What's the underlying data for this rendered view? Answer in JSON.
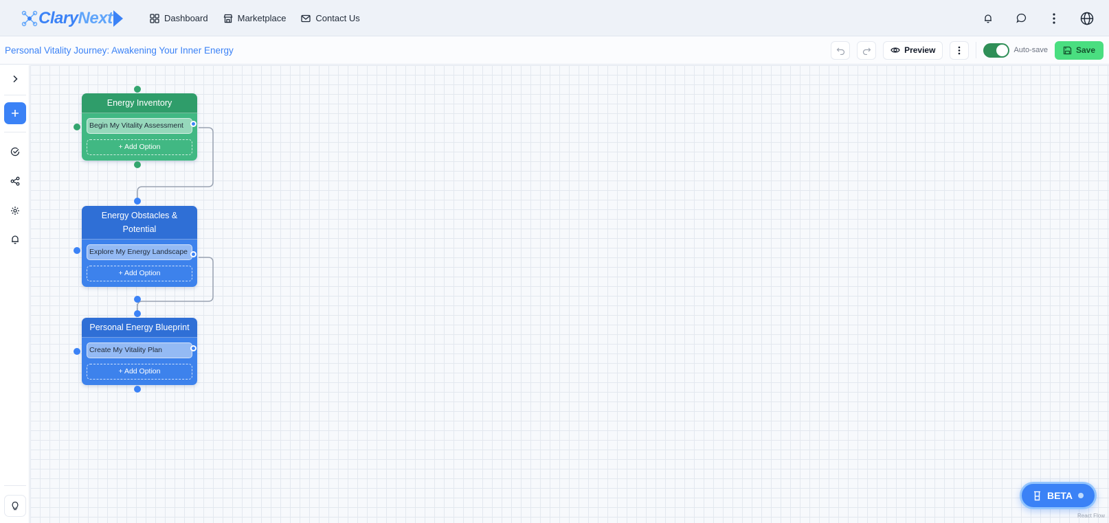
{
  "brand": {
    "part1": "Clary",
    "part2": "Next"
  },
  "nav": [
    {
      "label": "Dashboard",
      "icon": "dashboard-icon"
    },
    {
      "label": "Marketplace",
      "icon": "store-icon"
    },
    {
      "label": "Contact Us",
      "icon": "mail-icon"
    }
  ],
  "toolbar": {
    "flow_title": "Personal Vitality Journey: Awakening Your Inner Energy",
    "preview_label": "Preview",
    "autosave_label": "Auto-save",
    "autosave_on": true,
    "save_label": "Save"
  },
  "nodes": [
    {
      "title": "Energy Inventory",
      "color": "green",
      "options": [
        "Begin My Vitality Assessment"
      ],
      "add_label": "+ Add Option"
    },
    {
      "title": "Energy Obstacles & Potential",
      "color": "blue",
      "options": [
        "Explore My Energy Landscape"
      ],
      "add_label": "+ Add Option"
    },
    {
      "title": "Personal Energy Blueprint",
      "color": "blue",
      "options": [
        "Create My Vitality Plan"
      ],
      "add_label": "+ Add Option"
    }
  ],
  "beta": {
    "label": "BETA"
  },
  "attribution": "React Flow",
  "colors": {
    "accent": "#3b82f6",
    "green_node": "#41b883",
    "blue_node": "#3d82ec",
    "save": "#4ade80"
  }
}
